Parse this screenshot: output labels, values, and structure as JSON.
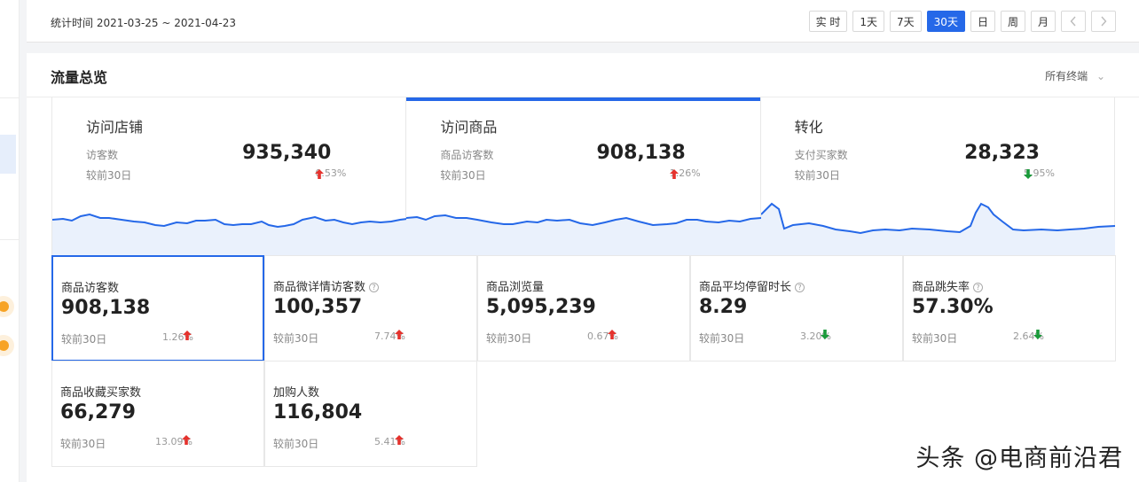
{
  "header": {
    "date_range": "统计时间 2021-03-25 ~ 2021-04-23",
    "buttons": [
      {
        "label": "实 时",
        "active": false
      },
      {
        "label": "1天",
        "active": false
      },
      {
        "label": "7天",
        "active": false
      },
      {
        "label": "30天",
        "active": true
      },
      {
        "label": "日",
        "active": false
      },
      {
        "label": "周",
        "active": false
      },
      {
        "label": "月",
        "active": false
      }
    ],
    "prev_icon": "chevron-left-icon",
    "next_icon": "chevron-right-icon"
  },
  "panel": {
    "title": "流量总览",
    "terminal_select": "所有终端"
  },
  "overview": [
    {
      "name": "访问店铺",
      "metric_label": "访客数",
      "value": "935,340",
      "compare_label": "较前30日",
      "change": "0.53%",
      "trend": "up",
      "active": false
    },
    {
      "name": "访问商品",
      "metric_label": "商品访客数",
      "value": "908,138",
      "compare_label": "较前30日",
      "change": "1.26%",
      "trend": "up",
      "active": true
    },
    {
      "name": "转化",
      "metric_label": "支付买家数",
      "value": "28,323",
      "compare_label": "较前30日",
      "change": "5.95%",
      "trend": "down",
      "active": false
    }
  ],
  "metrics": [
    {
      "name": "商品访客数",
      "help": false,
      "value": "908,138",
      "compare_label": "较前30日",
      "change": "1.26%",
      "trend": "up",
      "selected": true
    },
    {
      "name": "商品微详情访客数",
      "help": true,
      "value": "100,357",
      "compare_label": "较前30日",
      "change": "7.74%",
      "trend": "up",
      "selected": false
    },
    {
      "name": "商品浏览量",
      "help": false,
      "value": "5,095,239",
      "compare_label": "较前30日",
      "change": "0.67%",
      "trend": "up",
      "selected": false
    },
    {
      "name": "商品平均停留时长",
      "help": true,
      "value": "8.29",
      "compare_label": "较前30日",
      "change": "3.20%",
      "trend": "down",
      "selected": false
    },
    {
      "name": "商品跳失率",
      "help": true,
      "value": "57.30%",
      "compare_label": "较前30日",
      "change": "2.64%",
      "trend": "down",
      "selected": false
    },
    {
      "name": "商品收藏买家数",
      "help": false,
      "value": "66,279",
      "compare_label": "较前30日",
      "change": "13.09%",
      "trend": "up",
      "selected": false
    },
    {
      "name": "加购人数",
      "help": false,
      "value": "116,804",
      "compare_label": "较前30日",
      "change": "5.41%",
      "trend": "up",
      "selected": false
    }
  ],
  "colors": {
    "accent": "#2568e8",
    "up": "#e5322d",
    "down": "#1a9a3a",
    "spark_fill": "#eaf1fc"
  },
  "watermark": "头条 @电商前沿君"
}
